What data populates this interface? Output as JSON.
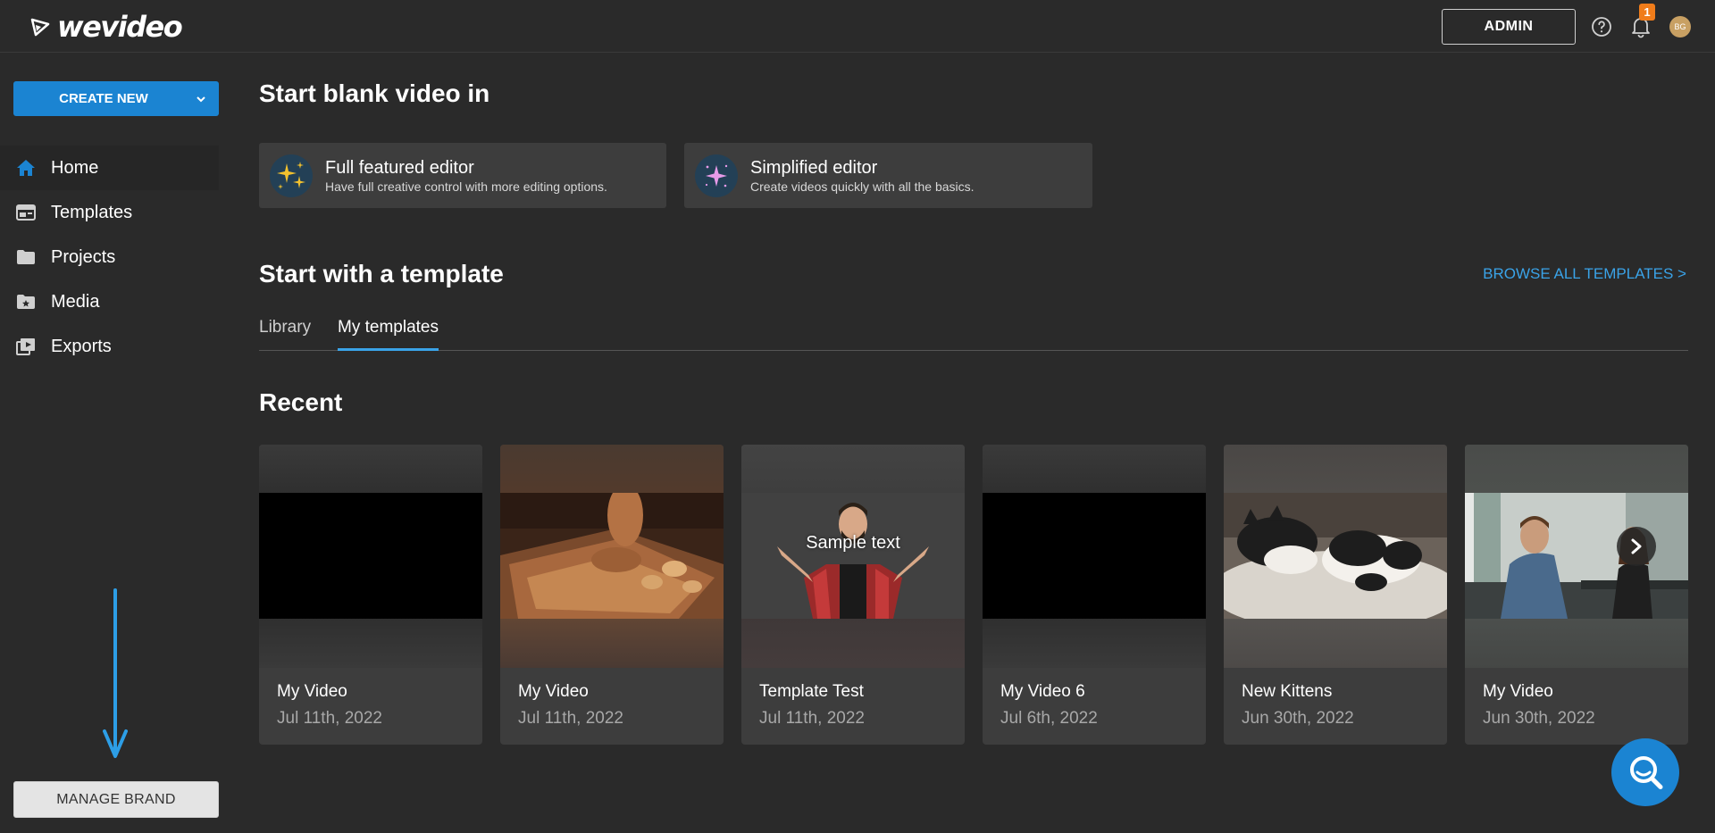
{
  "app": {
    "logo_text": "wevideo"
  },
  "header": {
    "admin_label": "ADMIN",
    "notification_count": "1",
    "avatar_initials": "BG"
  },
  "sidebar": {
    "create_new_label": "CREATE NEW",
    "items": [
      {
        "label": "Home",
        "icon": "home-icon",
        "active": true
      },
      {
        "label": "Templates",
        "icon": "templates-icon"
      },
      {
        "label": "Projects",
        "icon": "folder-icon"
      },
      {
        "label": "Media",
        "icon": "media-icon"
      },
      {
        "label": "Exports",
        "icon": "exports-icon"
      }
    ],
    "manage_brand_label": "MANAGE BRAND"
  },
  "main": {
    "blank_heading": "Start blank video in",
    "editors": [
      {
        "title": "Full featured editor",
        "subtitle": "Have full creative control with more editing options."
      },
      {
        "title": "Simplified editor",
        "subtitle": "Create videos quickly with all the basics."
      }
    ],
    "template_heading": "Start with a template",
    "browse_all": "BROWSE ALL TEMPLATES >",
    "tabs": [
      {
        "label": "Library",
        "active": false
      },
      {
        "label": "My templates",
        "active": true
      }
    ],
    "recent_heading": "Recent",
    "recent": [
      {
        "title": "My Video",
        "date": "Jul 11th, 2022",
        "thumb": "black"
      },
      {
        "title": "My Video",
        "date": "Jul 11th, 2022",
        "thumb": "chocolate"
      },
      {
        "title": "Template Test",
        "date": "Jul 11th, 2022",
        "thumb": "man",
        "overlay": "Sample text"
      },
      {
        "title": "My Video 6",
        "date": "Jul 6th, 2022",
        "thumb": "black"
      },
      {
        "title": "New Kittens",
        "date": "Jun 30th, 2022",
        "thumb": "kittens"
      },
      {
        "title": "My Video",
        "date": "Jun 30th, 2022",
        "thumb": "meeting"
      }
    ]
  },
  "colors": {
    "background": "#2a2a2a",
    "card": "#3d3d3d",
    "accent_blue": "#1b84d2",
    "link_blue": "#3aa3e8",
    "badge_orange": "#f07c1a"
  }
}
